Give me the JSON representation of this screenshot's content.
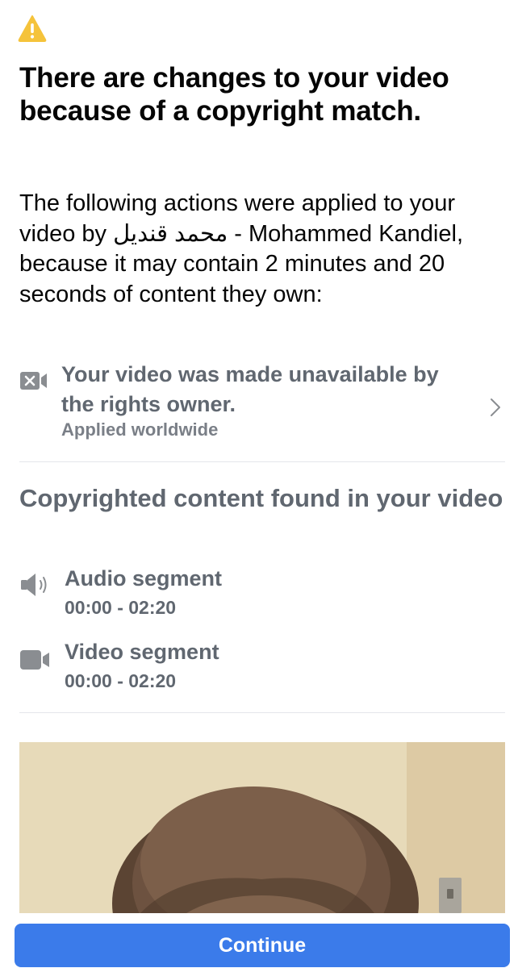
{
  "notice": {
    "icon": "warning-icon",
    "title": "There are changes to your video because of a copyright match.",
    "intro_before": "The following actions were applied to your video by ",
    "rights_owner": "محمد قنديل - Mohammed Kandiel",
    "intro_after": ", because it may contain 2 minutes and 20 seconds of content they own:"
  },
  "action": {
    "icon": "video-blocked-icon",
    "text": "Your video was made unavailable by the rights owner.",
    "scope": "Applied worldwide"
  },
  "content_found": {
    "title": "Copyrighted content found in your video",
    "segments": [
      {
        "icon": "speaker-icon",
        "label": "Audio segment",
        "time": "00:00 - 02:20"
      },
      {
        "icon": "video-camera-icon",
        "label": "Video segment",
        "time": "00:00 - 02:20"
      }
    ]
  },
  "footer": {
    "continue_label": "Continue"
  },
  "colors": {
    "accent": "#3b7bea",
    "warning": "#f5c33b",
    "muted_text": "#606770",
    "icon_gray": "#8a8d91"
  }
}
